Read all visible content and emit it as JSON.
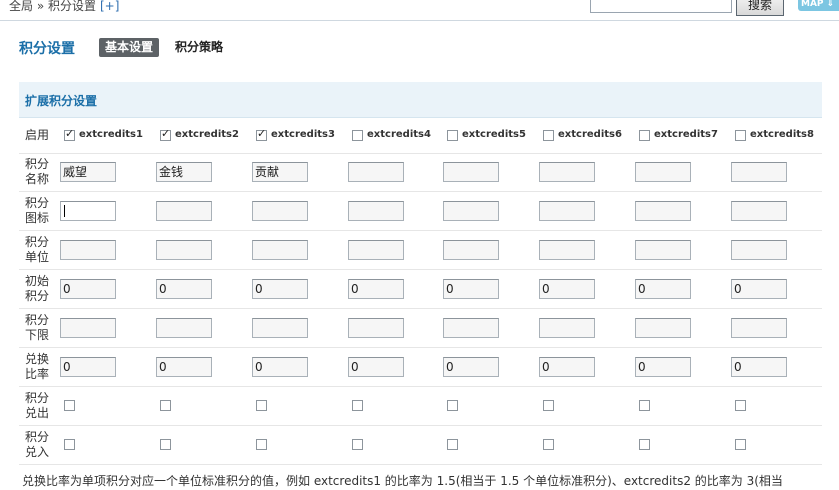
{
  "breadcrumb": {
    "text": "全局 » 积分设置",
    "add": "[+]"
  },
  "header": {
    "search_button": "搜索",
    "map_button": "MAP ⇓",
    "search_value": ""
  },
  "page_title": "积分设置",
  "tabs": [
    {
      "label": "基本设置",
      "active": true
    },
    {
      "label": "积分策略",
      "active": false
    }
  ],
  "section_title": "扩展积分设置",
  "enable_row": {
    "label": "启用",
    "items": [
      {
        "name": "extcredits1",
        "checked": true
      },
      {
        "name": "extcredits2",
        "checked": true
      },
      {
        "name": "extcredits3",
        "checked": true
      },
      {
        "name": "extcredits4",
        "checked": false
      },
      {
        "name": "extcredits5",
        "checked": false
      },
      {
        "name": "extcredits6",
        "checked": false
      },
      {
        "name": "extcredits7",
        "checked": false
      },
      {
        "name": "extcredits8",
        "checked": false
      }
    ]
  },
  "input_rows": [
    {
      "key": "name",
      "label": "积分名称",
      "values": [
        "威望",
        "金钱",
        "贡献",
        "",
        "",
        "",
        "",
        ""
      ]
    },
    {
      "key": "icon",
      "label": "积分图标",
      "values": [
        "",
        "",
        "",
        "",
        "",
        "",
        "",
        ""
      ]
    },
    {
      "key": "unit",
      "label": "积分单位",
      "values": [
        "",
        "",
        "",
        "",
        "",
        "",
        "",
        ""
      ]
    },
    {
      "key": "initial",
      "label": "初始积分",
      "values": [
        "0",
        "0",
        "0",
        "0",
        "0",
        "0",
        "0",
        "0"
      ]
    },
    {
      "key": "lower",
      "label": "积分下限",
      "values": [
        "",
        "",
        "",
        "",
        "",
        "",
        "",
        ""
      ]
    },
    {
      "key": "ratio",
      "label": "兑换比率",
      "values": [
        "0",
        "0",
        "0",
        "0",
        "0",
        "0",
        "0",
        "0"
      ]
    }
  ],
  "checkbox_rows": [
    {
      "key": "allow_out",
      "label": "积分兑出",
      "values": [
        false,
        false,
        false,
        false,
        false,
        false,
        false,
        false
      ]
    },
    {
      "key": "allow_in",
      "label": "积分兑入",
      "values": [
        false,
        false,
        false,
        false,
        false,
        false,
        false,
        false
      ]
    }
  ],
  "footnote": "兑换比率为单项积分对应一个单位标准积分的值，例如 extcredits1 的比率为 1.5(相当于 1.5 个单位标准积分)、extcredits2 的比率为 3(相当"
}
